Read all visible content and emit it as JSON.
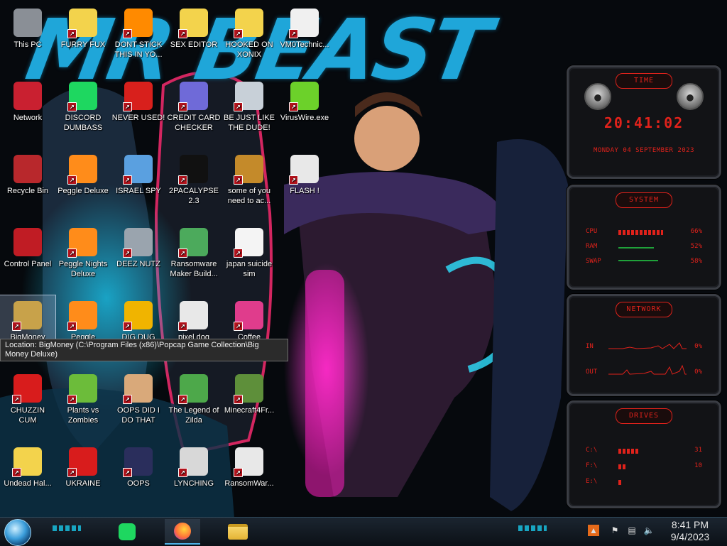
{
  "wallpaper": {
    "title": "MR BEAST"
  },
  "desktop_icons": [
    {
      "label": "This PC",
      "icon": "computer-icon",
      "color": "#8a8f96"
    },
    {
      "label": "FURRY FUX",
      "icon": "character-icon",
      "color": "#f3d34c"
    },
    {
      "label": "DONT STICK THIS IN YO...",
      "icon": "cone-icon",
      "color": "#ff8a00"
    },
    {
      "label": "SEX EDITOR",
      "icon": "character-icon",
      "color": "#f3d34c"
    },
    {
      "label": "HOOKED ON XONIX",
      "icon": "character-icon",
      "color": "#f3d34c"
    },
    {
      "label": "VM0Technic...",
      "icon": "doctor-icon",
      "color": "#f0f0f0"
    },
    {
      "label": "Network",
      "icon": "network-icon",
      "color": "#c92030"
    },
    {
      "label": "DISCORD DUMBASS",
      "icon": "spotify-icon",
      "color": "#1ed760"
    },
    {
      "label": "NEVER USED!",
      "icon": "dev-icon",
      "color": "#d8201c"
    },
    {
      "label": "CREDIT CARD CHECKER",
      "icon": "card-icon",
      "color": "#6f6ad8"
    },
    {
      "label": "BE JUST LIKE THE DUDE!",
      "icon": "santa-icon",
      "color": "#c8d0d8"
    },
    {
      "label": "VirusWire.exe",
      "icon": "lime-icon",
      "color": "#6cd12a"
    },
    {
      "label": "Recycle Bin",
      "icon": "recycle-bin-icon",
      "color": "#b8282c"
    },
    {
      "label": "Peggle Deluxe",
      "icon": "peggle-icon",
      "color": "#ff8c1a"
    },
    {
      "label": "ISRAEL SPY",
      "icon": "spy-icon",
      "color": "#5aa0e0"
    },
    {
      "label": "2PACALYPSE 2.3",
      "icon": "terminal-icon",
      "color": "#111111"
    },
    {
      "label": "some of you need to ac...",
      "icon": "dog-icon",
      "color": "#c48a2a"
    },
    {
      "label": "FLASH !",
      "icon": "flash-icon",
      "color": "#e8e8e8"
    },
    {
      "label": "Control Panel",
      "icon": "control-panel-icon",
      "color": "#c01c24"
    },
    {
      "label": "Peggle Nights Deluxe",
      "icon": "peggle-icon",
      "color": "#ff8c1a"
    },
    {
      "label": "DEEZ NUTZ",
      "icon": "windows-stack-icon",
      "color": "#9aa4ae"
    },
    {
      "label": "Ransomware Maker Build...",
      "icon": "app-window-icon",
      "color": "#4caa5c"
    },
    {
      "label": "japan suicide sim",
      "icon": "file-icon",
      "color": "#f4f4f4"
    },
    {
      "label": "BigMoney",
      "icon": "money-bag-icon",
      "color": "#c8a24a",
      "selected": true
    },
    {
      "label": "Peggle",
      "icon": "peggle-icon",
      "color": "#ff8c1a"
    },
    {
      "label": "DIG DUG",
      "icon": "de-icon",
      "color": "#f0b400"
    },
    {
      "label": "pixel dog",
      "icon": "pixel-dog-icon",
      "color": "#e8e8e8"
    },
    {
      "label": "Coffee",
      "icon": "monitor-icon",
      "color": "#e03c8c"
    },
    {
      "label": "CHUZZIN CUM",
      "icon": "chuzzle-icon",
      "color": "#d81c1c"
    },
    {
      "label": "Plants vs Zombies",
      "icon": "plant-icon",
      "color": "#6cbc3a"
    },
    {
      "label": "OOPS DID I DO THAT",
      "icon": "portrait-icon",
      "color": "#d9a97a"
    },
    {
      "label": "The Legend of Zilda",
      "icon": "zelda-icon",
      "color": "#4da84a"
    },
    {
      "label": "Minecraft4Fr...",
      "icon": "grass-block-icon",
      "color": "#5e8f3a"
    },
    {
      "label": "Undead Hal...",
      "icon": "character-icon",
      "color": "#f3d34c"
    },
    {
      "label": "UKRAINE",
      "icon": "radiation-icon",
      "color": "#d81c1c"
    },
    {
      "label": "OOPS",
      "icon": "oops-icon",
      "color": "#2a2e5c"
    },
    {
      "label": "LYNCHING",
      "icon": "lynch-icon",
      "color": "#d8d8d8"
    },
    {
      "label": "RansomWar...",
      "icon": "skull-icon",
      "color": "#e8e8e8"
    }
  ],
  "tooltip": {
    "text": "Location: BigMoney (C:\\Program Files (x86)\\Popcap Game Collection\\Big Money Deluxe)"
  },
  "gadgets": {
    "time": {
      "title": "TIME",
      "clock": "20:41:02",
      "date": "MONDAY 04 SEPTEMBER 2023"
    },
    "system": {
      "title": "SYSTEM",
      "rows": [
        {
          "name": "CPU",
          "value": "66%",
          "level": 0.66
        },
        {
          "name": "RAM",
          "value": "52%",
          "level": 0.52
        },
        {
          "name": "SWAP",
          "value": "58%",
          "level": 0.58
        }
      ]
    },
    "network": {
      "title": "NETWORK",
      "rows": [
        {
          "name": "IN",
          "value": "0%"
        },
        {
          "name": "OUT",
          "value": "0%"
        }
      ]
    },
    "drives": {
      "title": "DRIVES",
      "rows": [
        {
          "name": "C:\\",
          "value": "31",
          "level": 0.31
        },
        {
          "name": "F:\\",
          "value": "10",
          "level": 0.1
        },
        {
          "name": "E:\\",
          "value": "",
          "level": 0.05
        }
      ]
    }
  },
  "taskbar": {
    "start_icon": "windows-orb-icon",
    "pinned": [
      {
        "name": "spotify",
        "icon": "spotify-icon",
        "color": "#1ed760"
      },
      {
        "name": "firefox",
        "icon": "firefox-icon",
        "color": "#ff7139",
        "active": true
      },
      {
        "name": "file-explorer",
        "icon": "folder-icon",
        "color": "#f3c64a"
      }
    ],
    "tray_icons": [
      "hardware-icon",
      "flag-icon",
      "network-icon",
      "volume-icon"
    ],
    "clock": {
      "time": "8:41 PM",
      "date": "9/4/2023"
    }
  },
  "colors": {
    "gadget_red": "#e0221b",
    "accent_cyan": "#19c7e8",
    "wall_blue": "#1fa6d9"
  }
}
